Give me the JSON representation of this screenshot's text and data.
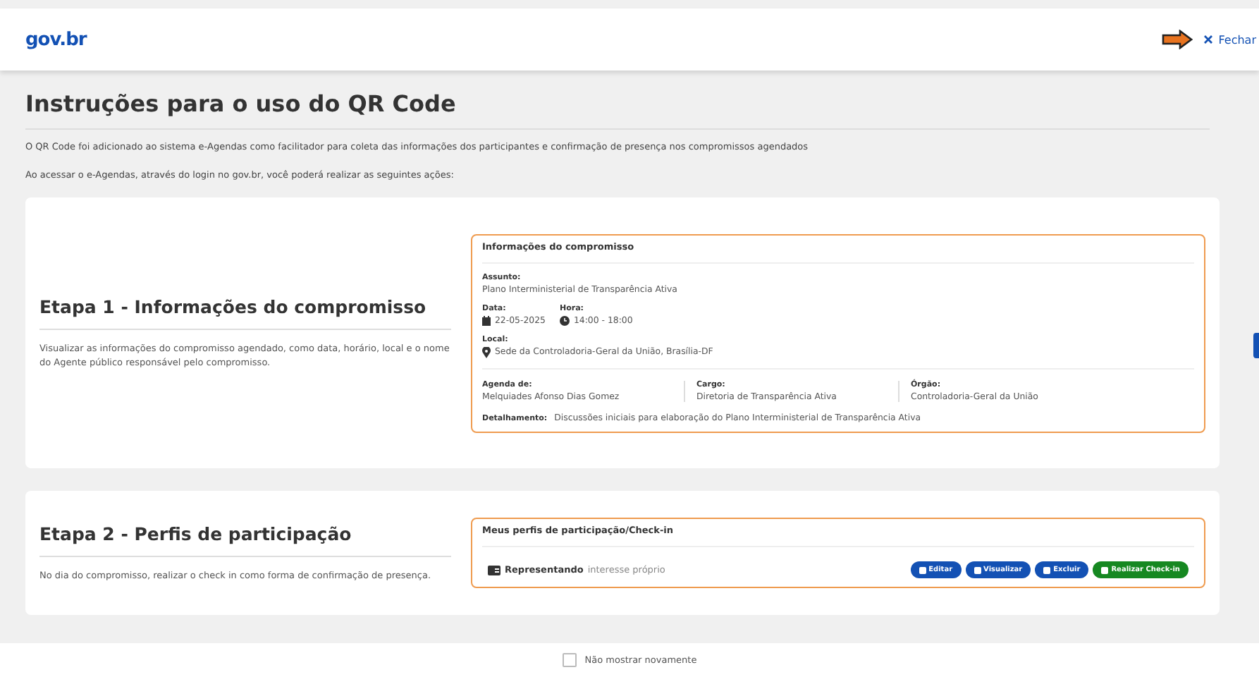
{
  "header": {
    "logo": "gov.br",
    "close": "Fechar"
  },
  "title": "Instruções para o uso do QR Code",
  "intro": [
    "O QR Code foi adicionado ao sistema e-Agendas como facilitador para coleta das informações dos participantes e confirmação de presença nos compromissos agendados",
    "Ao acessar o e-Agendas, através do login no gov.br, você poderá realizar as seguintes ações:"
  ],
  "steps": [
    {
      "kind": "info",
      "heading": "Etapa 1 - Informações do compromisso",
      "description": "Visualizar as informações do compromisso agendado, como data, horário, local e o nome do Agente público responsável pelo compromisso.",
      "panel": {
        "title": "Informações do compromisso",
        "subject_label": "Assunto:",
        "subject": "Plano Interministerial de Transparência Ativa",
        "date_label": "Data:",
        "date": "22-05-2025",
        "time_label": "Hora:",
        "time": "14:00 - 18:00",
        "place_label": "Local:",
        "place": "Sede da Controladoria-Geral da União, Brasília-DF",
        "people": [
          {
            "label": "Agenda de:",
            "value": "Melquiades Afonso Dias Gomez"
          },
          {
            "label": "Cargo:",
            "value": "Diretoria de Transparência Ativa"
          },
          {
            "label": "Órgão:",
            "value": "Controladoria-Geral da União"
          }
        ],
        "detail_label": "Detalhamento:",
        "detail": "Discussões iniciais para elaboração do Plano Interministerial de Transparência Ativa"
      }
    },
    {
      "kind": "profiles",
      "heading": "Etapa 2 - Perfis de participação",
      "description": "No dia do compromisso, realizar o check in como forma de confirmação de presença.",
      "panel": {
        "title": "Meus perfis de participação/Check-in",
        "role_label": "Representando",
        "role": "interesse próprio",
        "buttons": [
          {
            "label": "Editar",
            "color": "#1351b4"
          },
          {
            "label": "Visualizar",
            "color": "#1351b4"
          },
          {
            "label": "Excluir",
            "color": "#1351b4"
          },
          {
            "label": "Realizar Check-in",
            "color": "#168821"
          }
        ]
      }
    }
  ],
  "footer": {
    "checkbox": {
      "label": "Não mostrar novamente",
      "checked": false
    }
  }
}
